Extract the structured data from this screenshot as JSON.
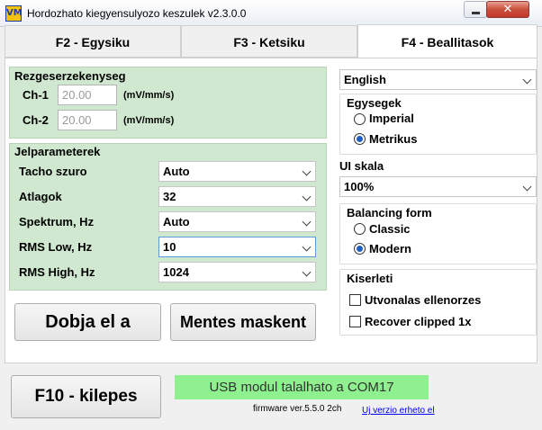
{
  "window": {
    "title": "Hordozhato kiegyensulyozo keszulek v2.3.0.0",
    "close_label": "✕"
  },
  "tabs": [
    {
      "label": "F2 - Egysiku"
    },
    {
      "label": "F3 - Ketsiku"
    },
    {
      "label": "F4 - Beallitasok"
    }
  ],
  "sensitivity": {
    "title": "Rezgeserzekenyseg",
    "channels": [
      {
        "label": "Ch-1",
        "value": "20.00",
        "unit": "(mV/mm/s)"
      },
      {
        "label": "Ch-2",
        "value": "20.00",
        "unit": "(mV/mm/s)"
      }
    ]
  },
  "signal_params": {
    "title": "Jelparameterek",
    "rows": [
      {
        "label": "Tacho szuro",
        "value": "Auto"
      },
      {
        "label": "Atlagok",
        "value": "32"
      },
      {
        "label": "Spektrum, Hz",
        "value": "Auto"
      },
      {
        "label": "RMS Low, Hz",
        "value": "10"
      },
      {
        "label": "RMS High, Hz",
        "value": "1024"
      }
    ]
  },
  "buttons": {
    "reset": "Dobja el a",
    "save_as": "Mentes maskent",
    "exit": "F10 - kilepes"
  },
  "language": {
    "value": "English"
  },
  "units": {
    "title": "Egysegek",
    "options": [
      {
        "label": "Imperial",
        "selected": false
      },
      {
        "label": "Metrikus",
        "selected": true
      }
    ]
  },
  "ui_scale": {
    "label": "UI skala",
    "value": "100%"
  },
  "balancing_form": {
    "title": "Balancing form",
    "options": [
      {
        "label": "Classic",
        "selected": false
      },
      {
        "label": "Modern",
        "selected": true
      }
    ]
  },
  "experimental": {
    "title": "Kiserleti",
    "options": [
      {
        "label": "Utvonalas ellenorzes",
        "checked": false
      },
      {
        "label": "Recover clipped 1x",
        "checked": false
      }
    ]
  },
  "status": {
    "usb": "USB modul talalhato a COM17",
    "firmware": "firmware ver.5.5.0 2ch",
    "update_link": "Uj verzio erheto el"
  },
  "colors": {
    "group_bg": "#cfe8cf",
    "usb_bg": "#8ef08e",
    "close_btn": "#c94e3c"
  }
}
